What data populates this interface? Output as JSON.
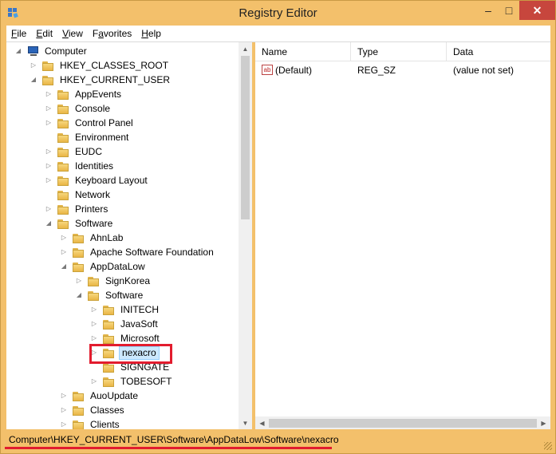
{
  "window": {
    "title": "Registry Editor",
    "controls": {
      "minimize": "–",
      "maximize": "□",
      "close": "✕"
    }
  },
  "menu": [
    "File",
    "Edit",
    "View",
    "Favorites",
    "Help"
  ],
  "menu_accel": [
    "F",
    "E",
    "V",
    "a",
    "H"
  ],
  "tree": {
    "items": [
      {
        "label": "Computer",
        "depth": 0,
        "expander": "open",
        "icon": "computer-icon"
      },
      {
        "label": "HKEY_CLASSES_ROOT",
        "depth": 1,
        "expander": "closed",
        "icon": "folder-icon"
      },
      {
        "label": "HKEY_CURRENT_USER",
        "depth": 1,
        "expander": "open",
        "icon": "folder-icon"
      },
      {
        "label": "AppEvents",
        "depth": 2,
        "expander": "closed",
        "icon": "folder-icon"
      },
      {
        "label": "Console",
        "depth": 2,
        "expander": "closed",
        "icon": "folder-icon"
      },
      {
        "label": "Control Panel",
        "depth": 2,
        "expander": "closed",
        "icon": "folder-icon"
      },
      {
        "label": "Environment",
        "depth": 2,
        "expander": "none",
        "icon": "folder-icon"
      },
      {
        "label": "EUDC",
        "depth": 2,
        "expander": "closed",
        "icon": "folder-icon"
      },
      {
        "label": "Identities",
        "depth": 2,
        "expander": "closed",
        "icon": "folder-icon"
      },
      {
        "label": "Keyboard Layout",
        "depth": 2,
        "expander": "closed",
        "icon": "folder-icon"
      },
      {
        "label": "Network",
        "depth": 2,
        "expander": "none",
        "icon": "folder-icon"
      },
      {
        "label": "Printers",
        "depth": 2,
        "expander": "closed",
        "icon": "folder-icon"
      },
      {
        "label": "Software",
        "depth": 2,
        "expander": "open",
        "icon": "folder-icon"
      },
      {
        "label": "AhnLab",
        "depth": 3,
        "expander": "closed",
        "icon": "folder-icon"
      },
      {
        "label": "Apache Software Foundation",
        "depth": 3,
        "expander": "closed",
        "icon": "folder-icon"
      },
      {
        "label": "AppDataLow",
        "depth": 3,
        "expander": "open",
        "icon": "folder-icon"
      },
      {
        "label": "SignKorea",
        "depth": 4,
        "expander": "closed",
        "icon": "folder-icon"
      },
      {
        "label": "Software",
        "depth": 4,
        "expander": "open",
        "icon": "folder-icon"
      },
      {
        "label": "INITECH",
        "depth": 5,
        "expander": "closed",
        "icon": "folder-icon"
      },
      {
        "label": "JavaSoft",
        "depth": 5,
        "expander": "closed",
        "icon": "folder-icon"
      },
      {
        "label": "Microsoft",
        "depth": 5,
        "expander": "closed",
        "icon": "folder-icon"
      },
      {
        "label": "nexacro",
        "depth": 5,
        "expander": "closed",
        "icon": "folder-icon",
        "selected": true
      },
      {
        "label": "SIGNGATE",
        "depth": 5,
        "expander": "none",
        "icon": "folder-icon"
      },
      {
        "label": "TOBESOFT",
        "depth": 5,
        "expander": "closed",
        "icon": "folder-icon"
      },
      {
        "label": "AuoUpdate",
        "depth": 3,
        "expander": "closed",
        "icon": "folder-icon"
      },
      {
        "label": "Classes",
        "depth": 3,
        "expander": "closed",
        "icon": "folder-icon"
      },
      {
        "label": "Clients",
        "depth": 3,
        "expander": "closed",
        "icon": "folder-icon"
      }
    ]
  },
  "list": {
    "columns": [
      "Name",
      "Type",
      "Data"
    ],
    "rows": [
      {
        "name": "(Default)",
        "type": "REG_SZ",
        "data": "(value not set)",
        "icon": "string-value-icon"
      }
    ],
    "value_icon_text": "ab"
  },
  "status": {
    "path": "Computer\\HKEY_CURRENT_USER\\Software\\AppDataLow\\Software\\nexacro"
  },
  "colors": {
    "frame": "#f3c06b",
    "close_button": "#c7463d",
    "annotation_red": "#e21c2e",
    "selection": "#cce8ff"
  }
}
